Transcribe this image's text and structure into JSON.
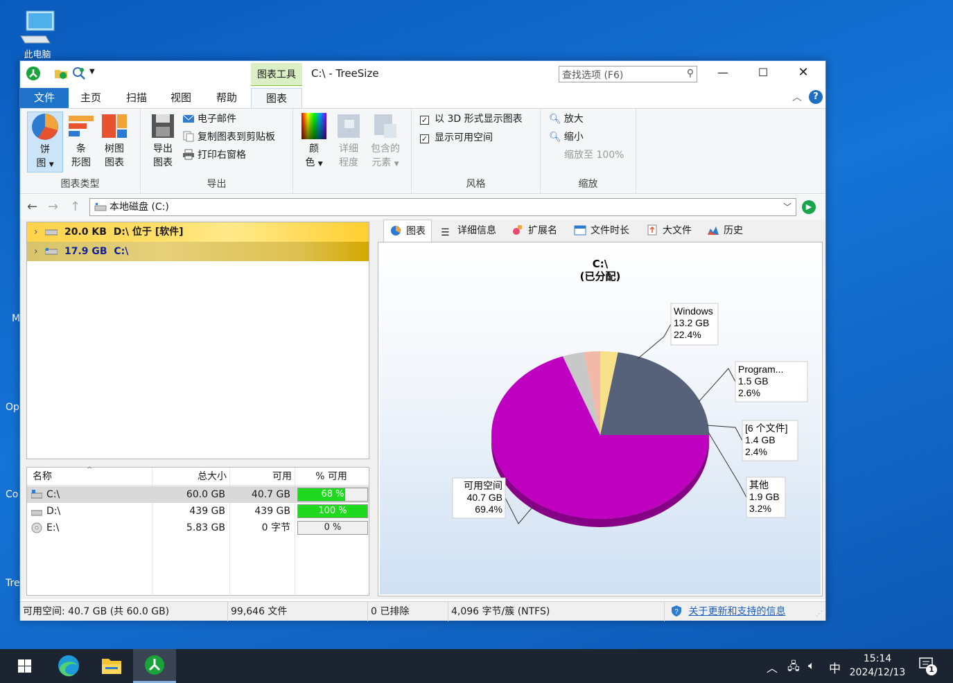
{
  "desktop": {
    "this_pc_label": "此电脑",
    "edge_labels": [
      "M",
      "Op",
      "Co",
      "Tre"
    ]
  },
  "window": {
    "context_tab_group": "图表工具",
    "title": "C:\\ - TreeSize",
    "search_placeholder": "查找选项 (F6)",
    "tabs": {
      "file": "文件",
      "home": "主页",
      "scan": "扫描",
      "view": "视图",
      "help": "帮助",
      "chart": "图表"
    }
  },
  "ribbon": {
    "chart_type": {
      "label": "图表类型",
      "pie_l1": "饼",
      "pie_l2": "图",
      "bar_l1": "条",
      "bar_l2": "形图",
      "tree_l1": "树图",
      "tree_l2": "图表"
    },
    "export": {
      "label": "导出",
      "export_l1": "导出",
      "export_l2": "图表",
      "email": "电子邮件",
      "copy": "复制图表到剪贴板",
      "print": "打印右窗格"
    },
    "colors": {
      "color_l1": "颜",
      "color_l2": "色",
      "detail_l1": "详细",
      "detail_l2": "程度",
      "contains_l1": "包含的",
      "contains_l2": "元素"
    },
    "style": {
      "label": "风格",
      "show_3d": "以 3D 形式显示图表",
      "show_free": "显示可用空间"
    },
    "zoom": {
      "label": "缩放",
      "zoom_in": "放大",
      "zoom_out": "缩小",
      "zoom_100": "缩放至 100%"
    }
  },
  "address": {
    "path": "本地磁盘 (C:)"
  },
  "tree": {
    "rows": [
      {
        "size": "20.0 KB",
        "text": "D:\\  位于  [软件]"
      },
      {
        "size": "17.9 GB",
        "text": "C:\\"
      }
    ]
  },
  "drive_list": {
    "headers": [
      "名称",
      "总大小",
      "可用",
      "% 可用"
    ],
    "rows": [
      {
        "name": "C:\\",
        "total": "60.0 GB",
        "free": "40.7 GB",
        "pct_label": "68 %",
        "pct": 68
      },
      {
        "name": "D:\\",
        "total": "439 GB",
        "free": "439 GB",
        "pct_label": "100 %",
        "pct": 100
      },
      {
        "name": "E:\\",
        "total": "5.83 GB",
        "free": "0 字节",
        "pct_label": "0 %",
        "pct": 0
      }
    ]
  },
  "right_tabs": [
    "图表",
    "详细信息",
    "扩展名",
    "文件时长",
    "大文件",
    "历史"
  ],
  "chart_data": {
    "type": "pie",
    "title": "C:\\",
    "subtitle": "(已分配)",
    "slices": [
      {
        "name": "Windows",
        "size": "13.2 GB",
        "percent": 22.4,
        "percent_label": "22.4%",
        "color": "#56627a"
      },
      {
        "name": "Program...",
        "size": "1.5 GB",
        "percent": 2.6,
        "percent_label": "2.6%",
        "color": "#f7e08a"
      },
      {
        "name": "[6 个文件]",
        "size": "1.4 GB",
        "percent": 2.4,
        "percent_label": "2.4%",
        "color": "#f2b8a8"
      },
      {
        "name": "其他",
        "size": "1.9 GB",
        "percent": 3.2,
        "percent_label": "3.2%",
        "color": "#c8c8c8"
      },
      {
        "name": "可用空间",
        "size": "40.7 GB",
        "percent": 69.4,
        "percent_label": "69.4%",
        "color": "#c000c0"
      }
    ]
  },
  "status": {
    "free": "可用空间: 40.7 GB (共 60.0 GB)",
    "files": "99,646 文件",
    "excluded": "0 已排除",
    "cluster": "4,096 字节/簇 (NTFS)",
    "link": "关于更新和支持的信息"
  },
  "taskbar": {
    "ime": "中",
    "time": "15:14",
    "date": "2024/12/13",
    "notif_count": "1"
  }
}
